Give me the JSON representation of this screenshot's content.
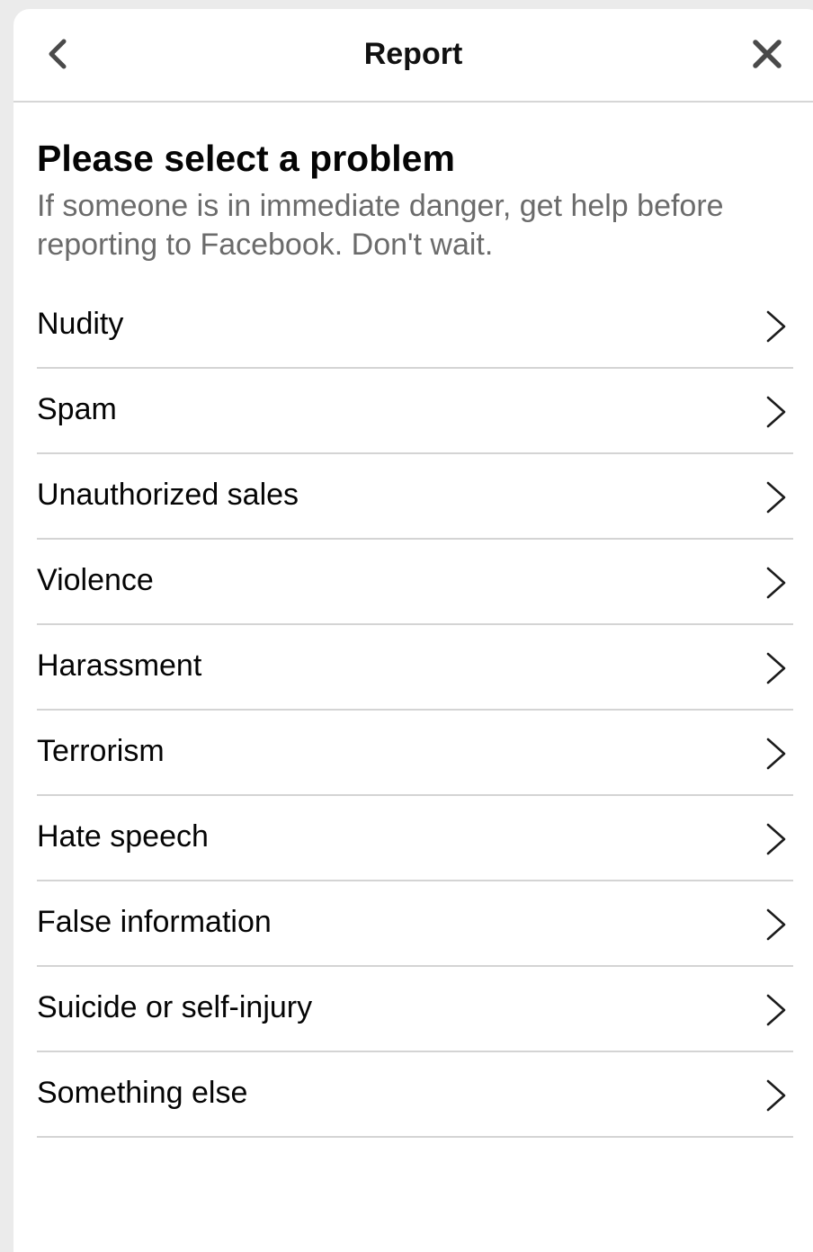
{
  "header": {
    "title": "Report",
    "back_icon": "chevron-left-icon",
    "close_icon": "close-icon"
  },
  "intro": {
    "heading": "Please select a problem",
    "description": "If someone is in immediate danger, get help before reporting to Facebook. Don't wait."
  },
  "problems": [
    {
      "label": "Nudity"
    },
    {
      "label": "Spam"
    },
    {
      "label": "Unauthorized sales"
    },
    {
      "label": "Violence"
    },
    {
      "label": "Harassment"
    },
    {
      "label": "Terrorism"
    },
    {
      "label": "Hate speech"
    },
    {
      "label": "False information"
    },
    {
      "label": "Suicide or self-injury"
    },
    {
      "label": "Something else"
    }
  ],
  "colors": {
    "text_primary": "#050505",
    "text_secondary": "#6b6b6b",
    "divider": "#d4d4d4",
    "background": "#ffffff"
  }
}
